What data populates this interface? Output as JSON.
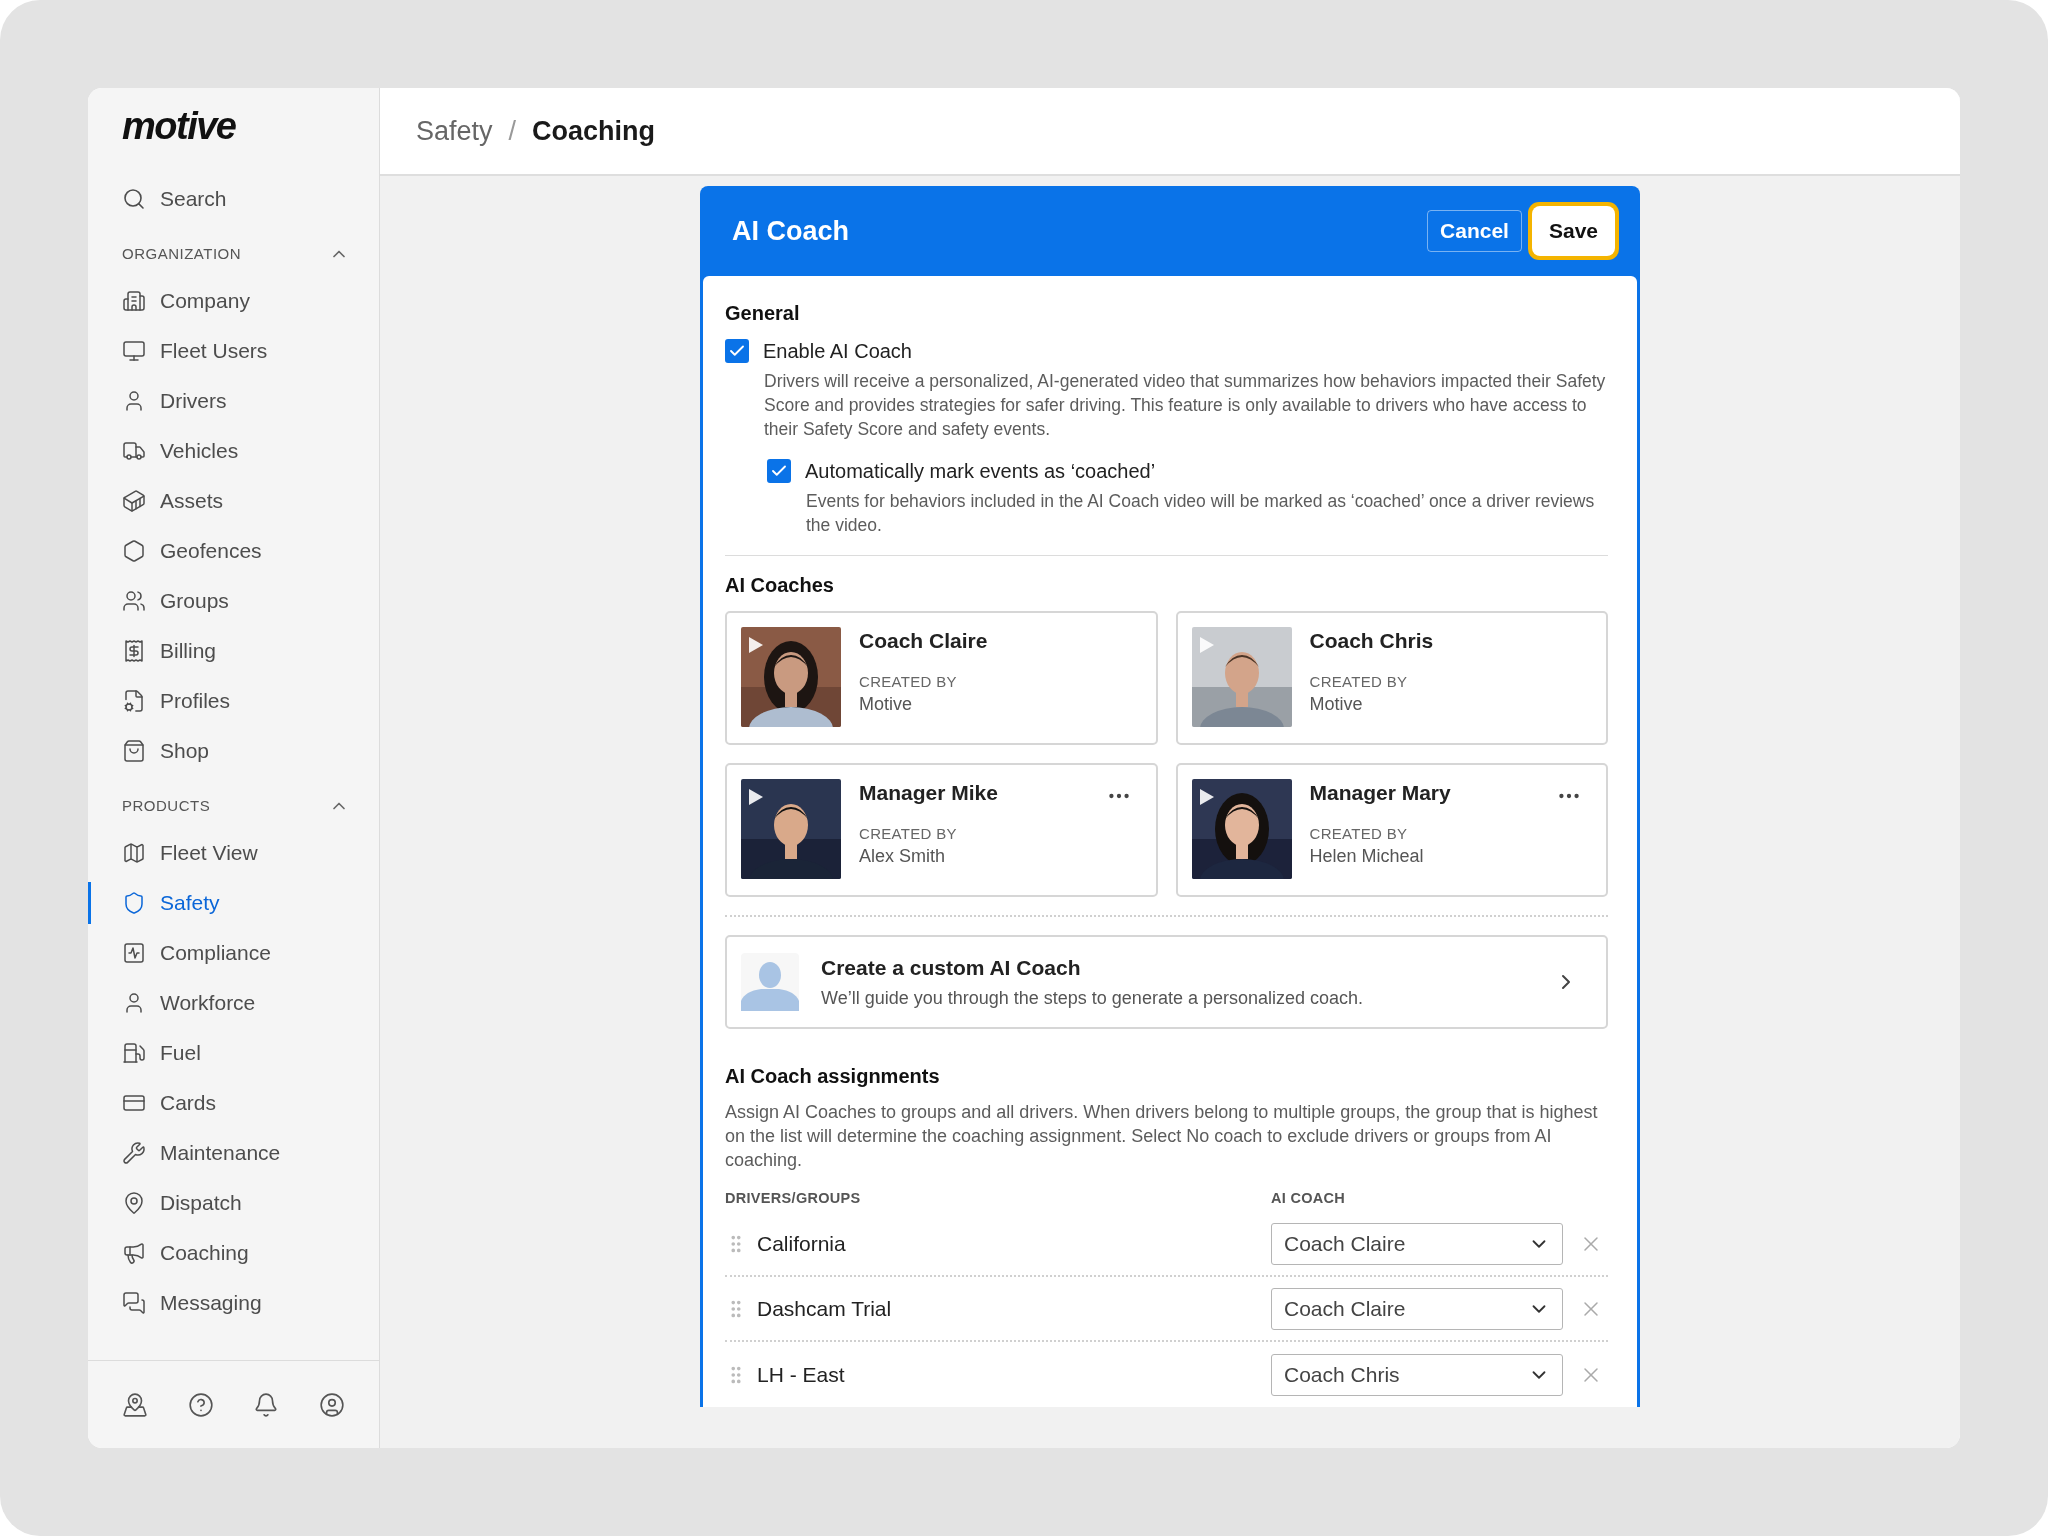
{
  "logo": "motive",
  "sidebar": {
    "search": {
      "label": "Search"
    },
    "sections": [
      {
        "title": "ORGANIZATION",
        "expanded": true,
        "items": [
          {
            "label": "Company",
            "selected": false
          },
          {
            "label": "Fleet Users",
            "selected": false
          },
          {
            "label": "Drivers",
            "selected": false
          },
          {
            "label": "Vehicles",
            "selected": false
          },
          {
            "label": "Assets",
            "selected": false
          },
          {
            "label": "Geofences",
            "selected": false
          },
          {
            "label": "Groups",
            "selected": false
          },
          {
            "label": "Billing",
            "selected": false
          },
          {
            "label": "Profiles",
            "selected": false
          },
          {
            "label": "Shop",
            "selected": false
          }
        ]
      },
      {
        "title": "PRODUCTS",
        "expanded": true,
        "items": [
          {
            "label": "Fleet View",
            "selected": false
          },
          {
            "label": "Safety",
            "selected": true
          },
          {
            "label": "Compliance",
            "selected": false
          },
          {
            "label": "Workforce",
            "selected": false
          },
          {
            "label": "Fuel",
            "selected": false
          },
          {
            "label": "Cards",
            "selected": false
          },
          {
            "label": "Maintenance",
            "selected": false
          },
          {
            "label": "Dispatch",
            "selected": false
          },
          {
            "label": "Coaching",
            "selected": false
          },
          {
            "label": "Messaging",
            "selected": false
          }
        ]
      }
    ]
  },
  "breadcrumb_separator": "/",
  "breadcrumb": [
    {
      "label": "Safety",
      "current": false
    },
    {
      "label": "Coaching",
      "current": true
    }
  ],
  "panel": {
    "title": "AI Coach",
    "buttons": [
      {
        "label": "Cancel",
        "kind": "secondary",
        "focused": false
      },
      {
        "label": "Save",
        "kind": "primary",
        "focused": true
      }
    ],
    "general": {
      "title": "General",
      "options": [
        {
          "label": "Enable AI Coach",
          "checked": true,
          "description": "Drivers will receive a personalized, AI-generated video that summarizes how behaviors impacted their Safety Score and provides strategies for safer driving. This feature is only available to drivers who have access to their Safety Score and safety events.",
          "children": [
            {
              "label": "Automatically mark events as ‘coached’",
              "checked": true,
              "description": "Events for behaviors included in the AI Coach video will be marked as ‘coached’ once a driver reviews the video."
            }
          ]
        }
      ]
    },
    "coaches": {
      "title": "AI Coaches",
      "items": [
        {
          "name": "Coach Claire",
          "created_by_label": "CREATED BY",
          "created_by": "Motive",
          "menu": false
        },
        {
          "name": "Coach Chris",
          "created_by_label": "CREATED BY",
          "created_by": "Motive",
          "menu": false
        },
        {
          "name": "Manager Mike",
          "created_by_label": "CREATED BY",
          "created_by": "Alex Smith",
          "menu": true
        },
        {
          "name": "Manager Mary",
          "created_by_label": "CREATED BY",
          "created_by": "Helen Micheal",
          "menu": true
        }
      ],
      "create": {
        "title": "Create a custom AI Coach",
        "subtitle": "We’ll guide you through the steps to generate a personalized coach."
      }
    },
    "assignments": {
      "title": "AI Coach assignments",
      "description": "Assign AI Coaches to groups and all drivers. When drivers belong to multiple groups, the group that is highest on the list will determine the coaching assignment. Select No coach to exclude drivers or groups from AI coaching.",
      "columns": [
        "DRIVERS/GROUPS",
        "AI COACH"
      ],
      "rows": [
        {
          "group": "California",
          "coach": "Coach Claire"
        },
        {
          "group": "Dashcam Trial",
          "coach": "Coach Claire"
        },
        {
          "group": "LH - East",
          "coach": "Coach Chris"
        }
      ]
    }
  }
}
